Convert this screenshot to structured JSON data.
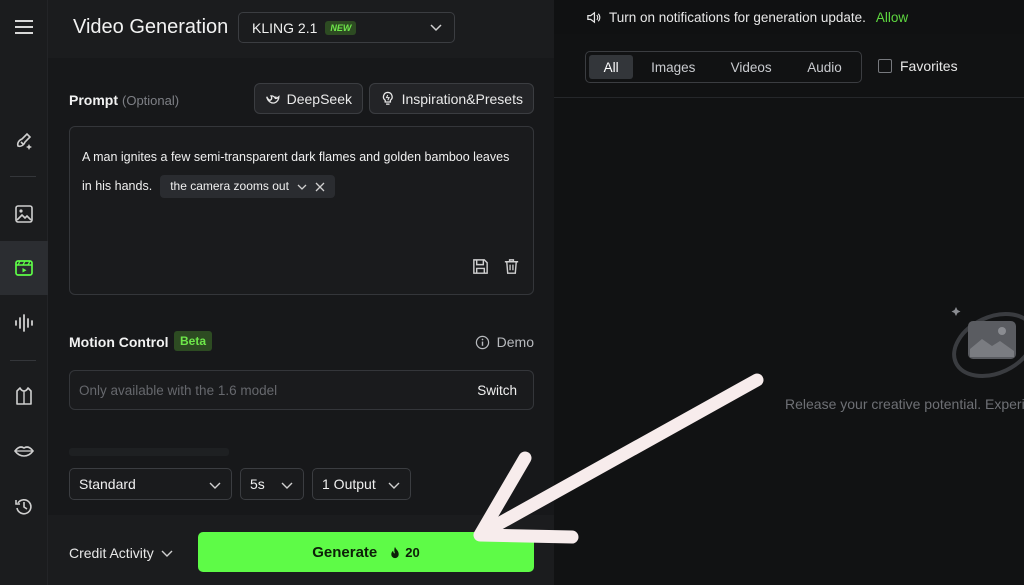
{
  "header": {
    "title": "Video Generation",
    "model": "KLING 2.1",
    "model_badge": "NEW"
  },
  "prompt": {
    "label": "Prompt",
    "optional": "(Optional)",
    "deepseek_label": "DeepSeek",
    "inspiration_label": "Inspiration&Presets",
    "text": "A man ignites a few semi-transparent dark flames and golden bamboo leaves in his hands.",
    "chip": "the camera zooms out"
  },
  "motion": {
    "label": "Motion Control",
    "badge": "Beta",
    "demo_label": "Demo",
    "placeholder": "Only available with the 1.6 model",
    "switch_label": "Switch"
  },
  "settings": {
    "mode": "Standard",
    "duration": "5s",
    "outputs": "1 Output"
  },
  "footer": {
    "credit_label": "Credit Activity",
    "generate_label": "Generate",
    "generate_cost": "20"
  },
  "notification": {
    "text": "Turn on notifications for generation update.",
    "action": "Allow"
  },
  "filters": {
    "tabs": [
      "All",
      "Images",
      "Videos",
      "Audio"
    ],
    "active_tab": "All",
    "favorites_label": "Favorites"
  },
  "empty_state": {
    "text": "Release your creative potential. Experi"
  },
  "rail": {
    "icons": [
      "menu-icon",
      "magic-brush-icon",
      "image-icon",
      "video-icon",
      "audio-wave-icon",
      "shirt-icon",
      "lips-icon",
      "history-icon"
    ],
    "active": "video-icon"
  },
  "colors": {
    "accent": "#5efb47",
    "badge_bg": "#2d4b22",
    "badge_text": "#6ee74a",
    "panel_bg": "#1b1c1e",
    "canvas_bg": "#111213"
  }
}
